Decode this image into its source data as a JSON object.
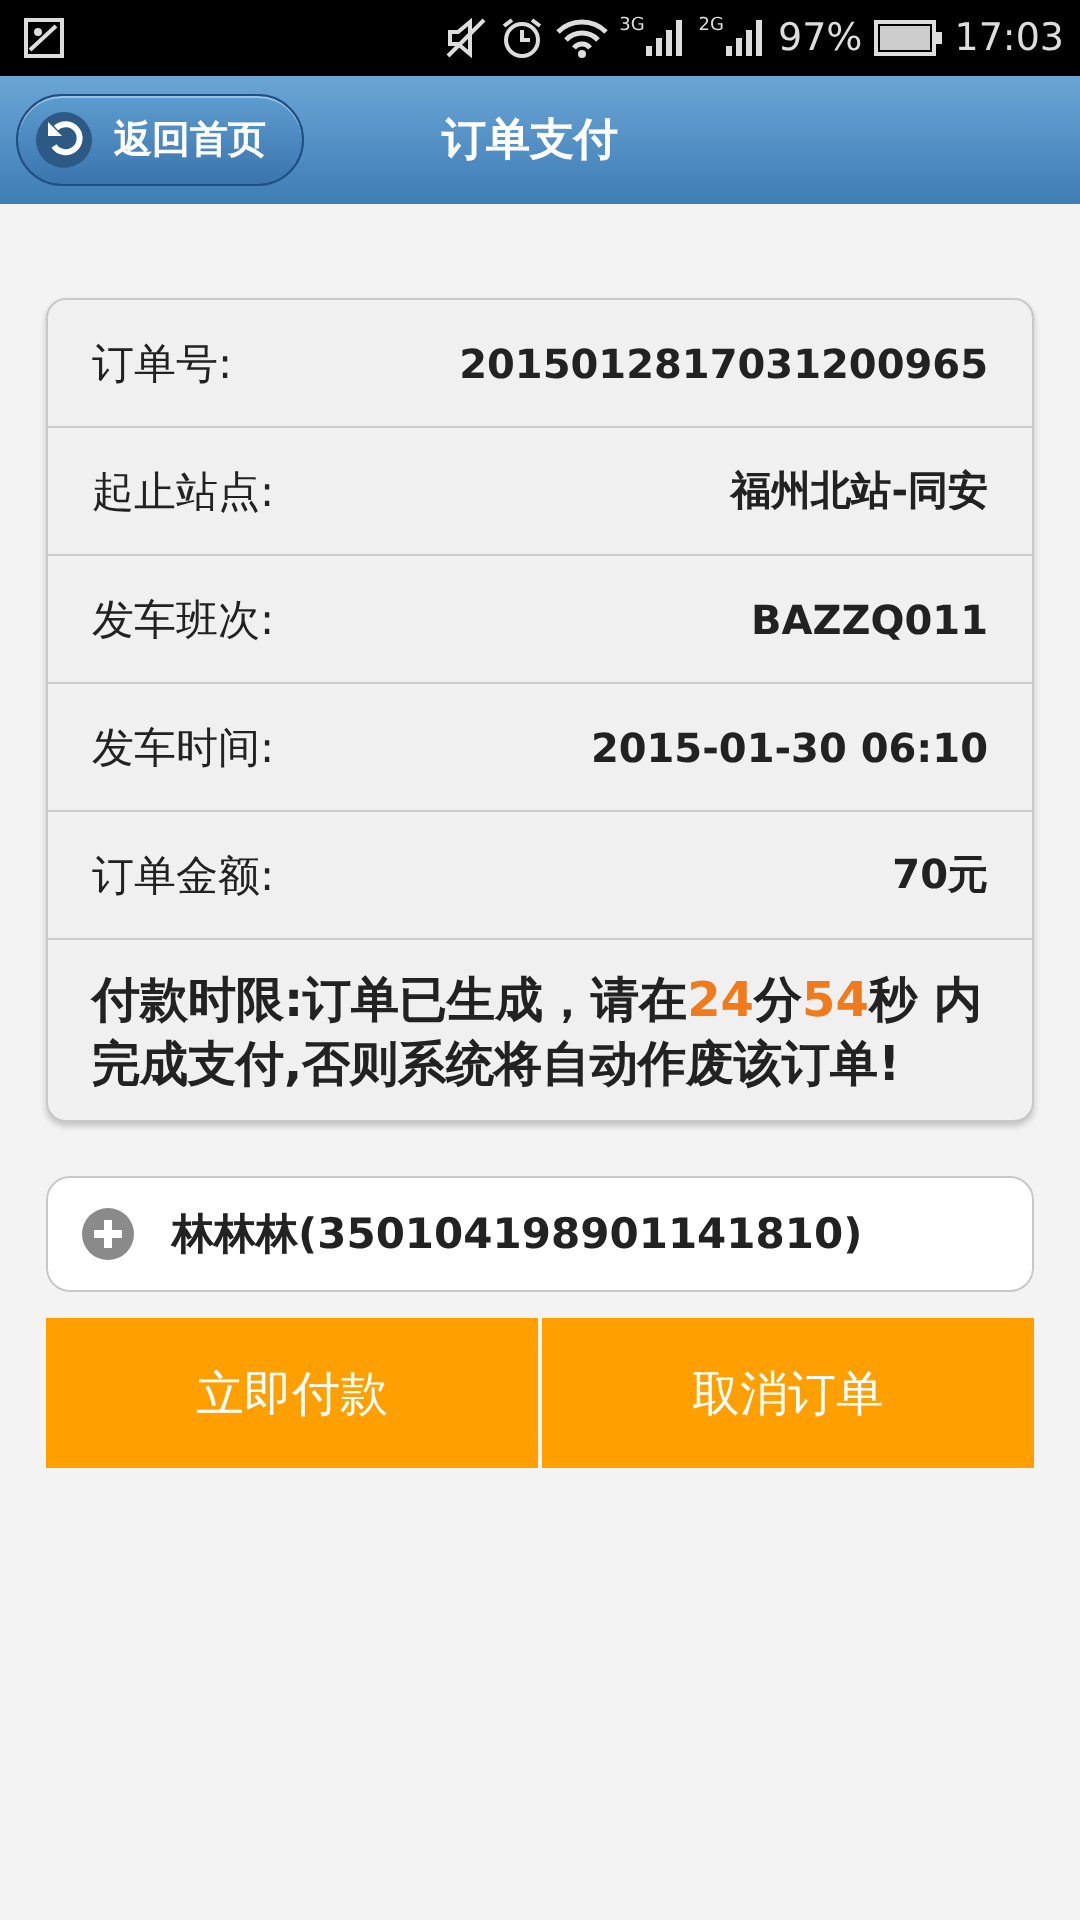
{
  "status_bar": {
    "network_labels": [
      "3G",
      "2G"
    ],
    "battery": "97%",
    "time": "17:03"
  },
  "header": {
    "back_button": "返回首页",
    "title": "订单支付"
  },
  "order_rows": [
    {
      "label": "订单号:",
      "value": "2015012817031200965"
    },
    {
      "label": "起止站点:",
      "value": "福州北站-同安"
    },
    {
      "label": "发车班次:",
      "value": "BAZZQ011"
    },
    {
      "label": "发车时间:",
      "value": "2015-01-30 06:10"
    },
    {
      "label": "订单金额:",
      "value": "70元"
    }
  ],
  "notice": [
    {
      "text": "付款时限:订单已生成，请在",
      "highlight": false
    },
    {
      "text": "24",
      "highlight": true
    },
    {
      "text": "分",
      "highlight": false
    },
    {
      "text": "54",
      "highlight": true
    },
    {
      "text": "秒 内完成支付,否则系统将自动作废该订单!",
      "highlight": false
    }
  ],
  "passenger": {
    "text": "林林林(350104198901141810)",
    "expanded": false
  },
  "buttons": [
    "立即付款",
    "取消订单"
  ]
}
